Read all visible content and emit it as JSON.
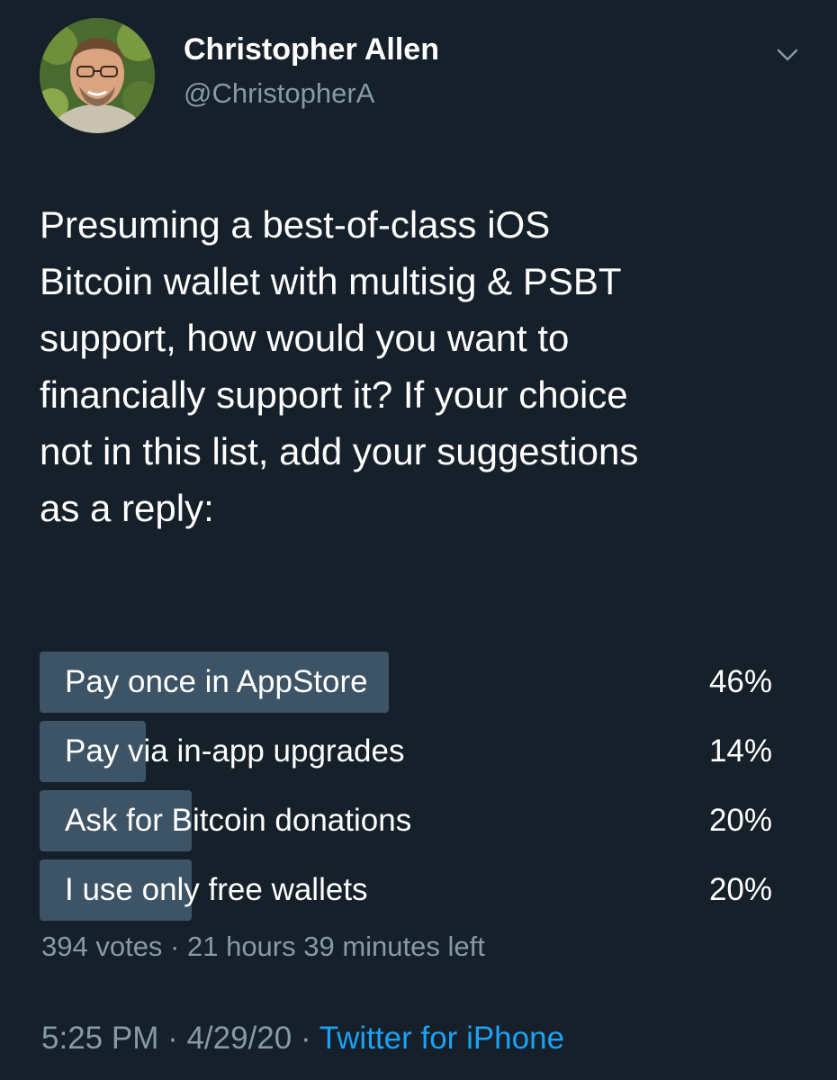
{
  "author": {
    "name": "Christopher Allen",
    "handle": "@ChristopherA"
  },
  "tweet": {
    "text": "Presuming a best-of-class iOS\nBitcoin wallet with multisig & PSBT\nsupport, how would you want to\nfinancially support it? If your choice\nnot in this list, add your suggestions\nas a reply:"
  },
  "poll": {
    "options": [
      {
        "label": "Pay once in AppStore",
        "percent_text": "46%",
        "percent": 46
      },
      {
        "label": "Pay via in-app upgrades",
        "percent_text": "14%",
        "percent": 14
      },
      {
        "label": "Ask for Bitcoin donations",
        "percent_text": "20%",
        "percent": 20
      },
      {
        "label": "I use only free wallets",
        "percent_text": "20%",
        "percent": 20
      }
    ],
    "meta": "394 votes · 21 hours 39 minutes left"
  },
  "footer": {
    "time": "5:25 PM · 4/29/20 · ",
    "source": "Twitter for iPhone"
  },
  "colors": {
    "background": "#15202b",
    "bar": "#3d5466",
    "secondary_text": "#8899a6",
    "link": "#1da1f2"
  },
  "icons": {
    "menu": "chevron-down-icon"
  }
}
